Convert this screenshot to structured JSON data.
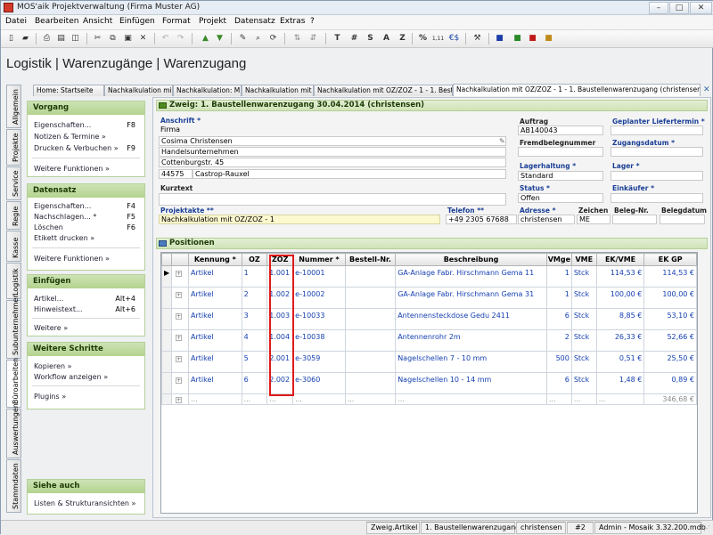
{
  "window": {
    "title": "MOS'aik Projektverwaltung (Firma Muster AG)",
    "btn_min": "–",
    "btn_max": "□",
    "btn_close": "✕"
  },
  "menu": [
    "Datei",
    "Bearbeiten",
    "Ansicht",
    "Einfügen",
    "Format",
    "Projekt",
    "Datensatz",
    "Extras",
    "?"
  ],
  "toolbar": {
    "text_buttons": [
      "T",
      "#",
      "S",
      "A",
      "Z",
      "%",
      "1,11",
      "€$"
    ]
  },
  "page_title": "Logistik | Warenzugänge | Warenzugang",
  "doc_tabs": [
    "Home: Startseite",
    "Nachkalkulation mit",
    "Nachkalkulation: M",
    "Nachkalkulation mit C",
    "Nachkalkulation mit OZ/ZOZ - 1 - 1. Best",
    "Nachkalkulation mit OZ/ZOZ - 1 - 1. Baustellenwarenzugang (christensen)"
  ],
  "vertical_tabs": [
    "Allgemein",
    "Projekte",
    "Service",
    "Regie",
    "Kasse",
    "Logistik",
    "Subunternehmer",
    "Büroarbeiten",
    "Auswertungen",
    "Stammdaten"
  ],
  "sidebar": {
    "vorgang": {
      "title": "Vorgang",
      "items": [
        {
          "label": "Eigenschaften...",
          "key": "F8"
        },
        {
          "label": "Notizen & Termine »",
          "key": ""
        },
        {
          "label": "Drucken & Verbuchen »",
          "key": "F9"
        }
      ],
      "more": "Weitere Funktionen »"
    },
    "datensatz": {
      "title": "Datensatz",
      "items": [
        {
          "label": "Eigenschaften...",
          "key": "F4"
        },
        {
          "label": "Nachschlagen... *",
          "key": "F5"
        },
        {
          "label": "Löschen",
          "key": "F6"
        },
        {
          "label": "Etikett drucken »",
          "key": ""
        }
      ],
      "more": "Weitere Funktionen »"
    },
    "einfuegen": {
      "title": "Einfügen",
      "items": [
        {
          "label": "Artikel...",
          "key": "Alt+4"
        },
        {
          "label": "Hinweistext...",
          "key": "Alt+6"
        }
      ],
      "more": "Weitere »"
    },
    "weitere": {
      "title": "Weitere Schritte",
      "items": [
        {
          "label": "Kopieren »",
          "key": ""
        },
        {
          "label": "Workflow anzeigen »",
          "key": ""
        }
      ],
      "more": "Plugins »"
    },
    "siehe": {
      "title": "Siehe auch",
      "items": [
        {
          "label": "Listen & Strukturansichten »",
          "key": ""
        }
      ]
    }
  },
  "zweig": "Zweig: 1. Baustellenwarenzugang 30.04.2014 (christensen)",
  "form": {
    "anschrift_label": "Anschrift *",
    "address": [
      "Firma",
      "Cosima Christensen",
      "Handelsunternehmen",
      "Cottenburgstr. 45"
    ],
    "plz": "44575",
    "ort": "Castrop-Rauxel",
    "kurztext_label": "Kurztext",
    "auftrag_label": "Auftrag",
    "auftrag": "AB140043",
    "fremd_label": "Fremdbelegnummer",
    "lagerhaltung_label": "Lagerhaltung *",
    "lagerhaltung": "Standard",
    "status_label": "Status *",
    "status": "Offen",
    "liefertermin_label": "Geplanter Liefertermin *",
    "zugangsdatum_label": "Zugangsdatum *",
    "lager_label": "Lager *",
    "einkaeufer_label": "Einkäufer *",
    "projektakte_label": "Projektakte **",
    "projektakte": "Nachkalkulation mit OZ/ZOZ - 1",
    "telefon_label": "Telefon **",
    "telefon": "+49 2305 67688",
    "adresse_label": "Adresse *",
    "adresse": "christensen",
    "zeichen_label": "Zeichen",
    "zeichen": "ME",
    "belegnr_label": "Beleg-Nr.",
    "belegdatum_label": "Belegdatum"
  },
  "positionen": {
    "title": "Positionen",
    "columns": [
      "Kennung *",
      "OZ",
      "ZOZ",
      "Nummer *",
      "Bestell-Nr.",
      "Beschreibung",
      "VMge",
      "VME",
      "EK/VME",
      "EK GP"
    ],
    "rows": [
      [
        "Artikel",
        "1",
        "1.001",
        "e-10001",
        "",
        "GA-Anlage Fabr. Hirschmann Gema 11",
        "1",
        "Stck",
        "114,53 €",
        "114,53 €"
      ],
      [
        "Artikel",
        "2",
        "1.002",
        "e-10002",
        "",
        "GA-Anlage Fabr. Hirschmann Gema 31",
        "1",
        "Stck",
        "100,00 €",
        "100,00 €"
      ],
      [
        "Artikel",
        "3",
        "1.003",
        "e-10033",
        "",
        "Antennensteckdose Gedu 2411",
        "6",
        "Stck",
        "8,85 €",
        "53,10 €"
      ],
      [
        "Artikel",
        "4",
        "1.004",
        "e-10038",
        "",
        "Antennenrohr 2m",
        "2",
        "Stck",
        "26,33 €",
        "52,66 €"
      ],
      [
        "Artikel",
        "5",
        "2.001",
        "e-3059",
        "",
        "Nagelschellen 7 - 10 mm",
        "500",
        "Stck",
        "0,51 €",
        "25,50 €"
      ],
      [
        "Artikel",
        "6",
        "2.002",
        "e-3060",
        "",
        "Nagelschellen 10 - 14 mm",
        "6",
        "Stck",
        "1,48 €",
        "0,89 €"
      ]
    ],
    "summary": [
      "...",
      "...",
      "...",
      "...",
      "...",
      "...",
      "...",
      "...",
      "...",
      "346,68 €"
    ]
  },
  "statusbar": [
    "Zweig.Artikel",
    "1. Baustellenwarenzugang",
    "christensen",
    "#2",
    "Admin - Mosaik 3.32.200.mdb"
  ],
  "colors": {
    "accent_green": "#b4d38f",
    "link_blue": "#1540b0",
    "highlight_red": "#e01a1a",
    "yellow_field": "#fcf8cf"
  }
}
